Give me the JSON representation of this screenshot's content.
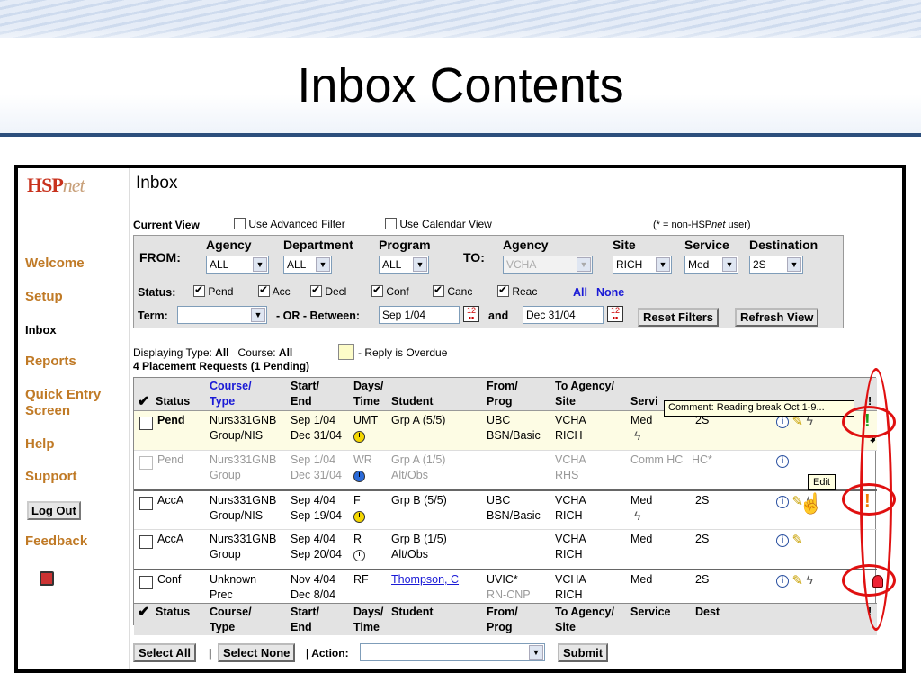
{
  "slide": {
    "title": "Inbox Contents"
  },
  "sidebar": {
    "logo_main": "HSP",
    "logo_sub": "net",
    "items": [
      {
        "label": "Welcome",
        "current": false
      },
      {
        "label": "Setup",
        "current": false
      },
      {
        "label": "Inbox",
        "current": true
      },
      {
        "label": "Reports",
        "current": false
      },
      {
        "label": "Quick Entry Screen",
        "current": false
      },
      {
        "label": "Help",
        "current": false
      },
      {
        "label": "Support",
        "current": false
      }
    ],
    "logout": "Log Out",
    "feedback": "Feedback"
  },
  "page": {
    "title": "Inbox"
  },
  "view": {
    "label": "Current View",
    "advanced_filter": "Use Advanced Filter",
    "calendar_view": "Use Calendar View",
    "note_prefix": "(* = non-HSP",
    "note_italic": "net",
    "note_suffix": " user)"
  },
  "filter": {
    "from_label": "FROM:",
    "to_label": "TO:",
    "agency_label": "Agency",
    "department_label": "Department",
    "program_label": "Program",
    "to_agency_label": "Agency",
    "site_label": "Site",
    "service_label": "Service",
    "destination_label": "Destination",
    "agency_value": "ALL",
    "department_value": "ALL",
    "program_value": "ALL",
    "to_agency_value": "VCHA",
    "site_value": "RICH",
    "service_value": "Med",
    "destination_value": "2S",
    "status_label": "Status:",
    "statuses": [
      "Pend",
      "Acc",
      "Decl",
      "Conf",
      "Canc",
      "Reac"
    ],
    "all": "All",
    "none": "None",
    "term_label": "Term:",
    "or_between": "- OR -  Between:",
    "start_date": "Sep 1/04",
    "and": "and",
    "end_date": "Dec 31/04",
    "reset": "Reset Filters",
    "refresh": "Refresh View"
  },
  "summary": {
    "displaying_type_label": "Displaying Type:",
    "displaying_type_value": "All",
    "course_label": "Course:",
    "course_value": "All",
    "overdue_legend": "- Reply is Overdue",
    "count": "4 Placement Requests (1 Pending)"
  },
  "table": {
    "headers": {
      "check": "✔",
      "status": "Status",
      "course": "Course/",
      "type": "Type",
      "start": "Start/",
      "end": "End",
      "days": "Days/",
      "time": "Time",
      "student": "Student",
      "from": "From/",
      "prog": "Prog",
      "to_agency": "To Agency/",
      "site": "Site",
      "service": "Servi",
      "service_full": "Service",
      "dest": "Dest",
      "flag": "!"
    },
    "rows": [
      {
        "status": "Pend",
        "course": "Nurs331GNB",
        "type": "Group/NIS",
        "start": "Sep 1/04",
        "end": "Dec 31/04",
        "days": "UMT",
        "student": "Grp A (5/5)",
        "from": "UBC",
        "prog": "BSN/Basic",
        "to_agency": "VCHA",
        "site": "RICH",
        "service": "Med",
        "dest": "2S",
        "flag": "!"
      },
      {
        "status": "Pend",
        "course": "Nurs331GNB",
        "type": "Group",
        "start": "Sep 1/04",
        "end": "Dec 31/04",
        "days": "WR",
        "student": "Grp A (1/5)",
        "from": "",
        "prog": "Alt/Obs",
        "to_agency": "VCHA",
        "site": "RHS",
        "service": "Comm HC",
        "dest": "HC*",
        "flag": ""
      },
      {
        "status": "AccA",
        "course": "Nurs331GNB",
        "type": "Group/NIS",
        "start": "Sep 4/04",
        "end": "Sep 19/04",
        "days": "F",
        "student": "Grp B (5/5)",
        "from": "UBC",
        "prog": "BSN/Basic",
        "to_agency": "VCHA",
        "site": "RICH",
        "service": "Med",
        "dest": "2S",
        "flag": "!"
      },
      {
        "status": "AccA",
        "course": "Nurs331GNB",
        "type": "Group",
        "start": "Sep 4/04",
        "end": "Sep 20/04",
        "days": "R",
        "student": "Grp B (1/5)",
        "from": "",
        "prog": "Alt/Obs",
        "to_agency": "VCHA",
        "site": "RICH",
        "service": "Med",
        "dest": "2S",
        "flag": ""
      },
      {
        "status": "Conf",
        "course": "Unknown",
        "type": "Prec",
        "start": "Nov 4/04",
        "end": "Dec 8/04",
        "days": "RF",
        "student": "Thompson, C",
        "from": "UVIC*",
        "prog": "RN-CNP",
        "to_agency": "VCHA",
        "site": "RICH",
        "service": "Med",
        "dest": "2S",
        "flag": ""
      }
    ]
  },
  "comment": "Comment: Reading break Oct 1-9...",
  "tooltip": "Edit",
  "actions": {
    "select_all": "Select All",
    "select_none": "Select None",
    "sep": "|",
    "action_label": "| Action:",
    "submit": "Submit"
  }
}
